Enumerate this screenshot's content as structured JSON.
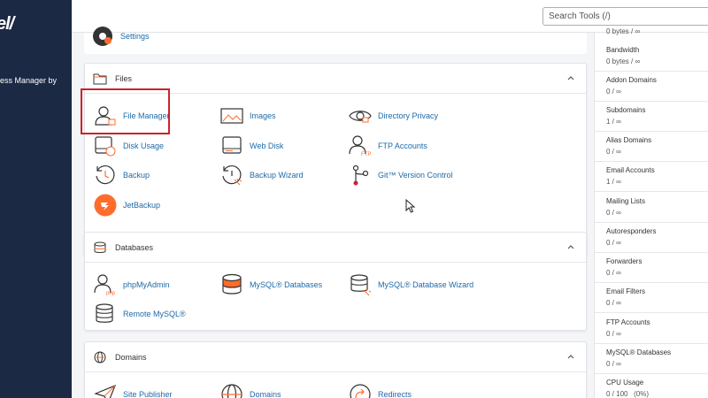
{
  "sidebar": {
    "logo": "el/",
    "text": "ess Manager by"
  },
  "header": {
    "search_placeholder": "Search Tools (/)"
  },
  "settings": {
    "label": "Settings"
  },
  "panels": {
    "files": {
      "title": "Files",
      "items": [
        "File Manager",
        "Images",
        "Directory Privacy",
        "Disk Usage",
        "Web Disk",
        "FTP Accounts",
        "Backup",
        "Backup Wizard",
        "Git™ Version Control",
        "JetBackup"
      ]
    },
    "databases": {
      "title": "Databases",
      "items": [
        "phpMyAdmin",
        "MySQL® Databases",
        "MySQL® Database Wizard",
        "Remote MySQL®"
      ]
    },
    "domains": {
      "title": "Domains",
      "items": [
        "Site Publisher",
        "Domains",
        "Redirects"
      ]
    }
  },
  "stats": {
    "top_value": "0 bytes / ∞",
    "items": [
      {
        "label": "Bandwidth",
        "value": "0 bytes / ∞"
      },
      {
        "label": "Addon Domains",
        "value": "0 / ∞"
      },
      {
        "label": "Subdomains",
        "value": "1 / ∞"
      },
      {
        "label": "Alias Domains",
        "value": "0 / ∞"
      },
      {
        "label": "Email Accounts",
        "value": "1 / ∞"
      },
      {
        "label": "Mailing Lists",
        "value": "0 / ∞"
      },
      {
        "label": "Autoresponders",
        "value": "0 / ∞"
      },
      {
        "label": "Forwarders",
        "value": "0 / ∞"
      },
      {
        "label": "Email Filters",
        "value": "0 / ∞"
      },
      {
        "label": "FTP Accounts",
        "value": "0 / ∞"
      },
      {
        "label": "MySQL® Databases",
        "value": "0 / ∞"
      },
      {
        "label": "CPU Usage",
        "value": "0 / 100   (0%)"
      }
    ]
  },
  "colors": {
    "sidebar": "#1c2944",
    "link": "#1d6aa8",
    "accent": "#ff6c2c",
    "highlight": "#c9232d"
  },
  "icons": {
    "settings": "gear-icon",
    "files": "folder-icon",
    "databases": "database-icon",
    "domains": "globe-icon",
    "chevron": "chevron-up-icon"
  }
}
